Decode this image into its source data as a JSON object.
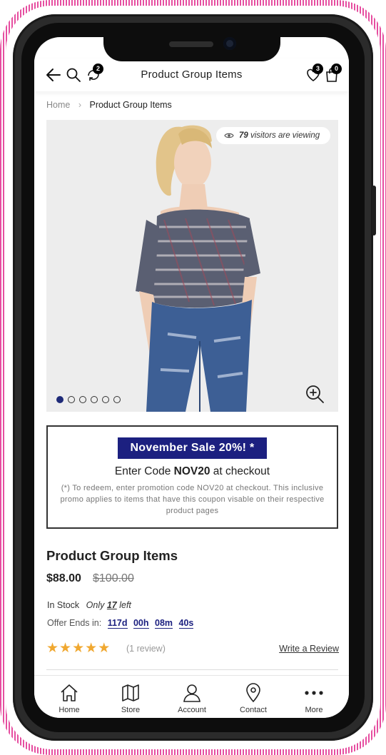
{
  "header": {
    "title": "Product Group Items",
    "compare_count": "2",
    "wishlist_count": "3",
    "cart_count": "0"
  },
  "breadcrumb": {
    "home": "Home",
    "current": "Product Group Items"
  },
  "gallery": {
    "visitors_count": "79",
    "visitors_text": "visitors are viewing",
    "total_slides": 6,
    "active_slide": 1
  },
  "promo": {
    "title": "November Sale 20%! *",
    "code_prefix": "Enter Code",
    "code": "NOV20",
    "code_suffix": "at checkout",
    "note": "(*) To redeem, enter promotion code NOV20 at checkout. This inclusive promo applies to items that have this coupon visable on their respective product pages"
  },
  "product": {
    "title": "Product Group Items",
    "price": "$88.00",
    "old_price": "$100.00",
    "stock_label": "In Stock",
    "only_label": "Only",
    "stock_qty": "17",
    "left_label": "left",
    "offer_label": "Offer Ends in:",
    "timer": {
      "days": "117d",
      "hours": "00h",
      "minutes": "08m",
      "seconds": "40s"
    },
    "rating": 5,
    "reviews_text": "(1 review)",
    "write_review": "Write a Review"
  },
  "tabbar": {
    "items": [
      {
        "label": "Home",
        "icon": "home-icon"
      },
      {
        "label": "Store",
        "icon": "map-icon"
      },
      {
        "label": "Account",
        "icon": "user-icon"
      },
      {
        "label": "Contact",
        "icon": "location-pin-icon"
      },
      {
        "label": "More",
        "icon": "more-dots-icon"
      }
    ]
  },
  "colors": {
    "accent": "#1c2080",
    "star": "#f0a830",
    "frame_pink": "#e64ea0"
  }
}
